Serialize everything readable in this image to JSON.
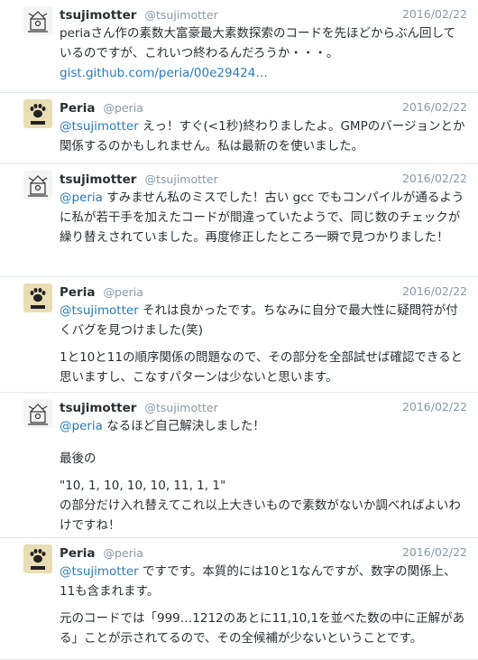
{
  "tweets": [
    {
      "author": "tsujimotter",
      "handle": "@tsujimotter",
      "date": "2016/02/22",
      "avatar_icon": "rocket-doodle-icon",
      "paragraphs": [
        "periaさん作の素数大富豪最大素数探索のコードを先ほどからぶん回しているのですが、これいつ終わるんだろうか・・・。"
      ],
      "link": "gist.github.com/peria/00e29424…"
    },
    {
      "author": "Peria",
      "handle": "@peria",
      "date": "2016/02/22",
      "avatar_icon": "paw-print-icon",
      "mention": "@tsujimotter",
      "first_text": " えっ！すぐ(<1秒)終わりましたよ。GMPのバージョンとか関係するのかもしれません。私は最新のを使いました。",
      "paragraphs": []
    },
    {
      "author": "tsujimotter",
      "handle": "@tsujimotter",
      "date": "2016/02/22",
      "avatar_icon": "rocket-doodle-icon",
      "mention": "@peria",
      "first_text": " すみません私のミスでした！古い gcc でもコンパイルが通るように私が若干手を加えたコードが間違っていたようで、同じ数のチェックが繰り替えされていました。再度修正したところ一瞬で見つかりました！",
      "paragraphs": []
    },
    {
      "author": "Peria",
      "handle": "@peria",
      "date": "2016/02/22",
      "avatar_icon": "paw-print-icon",
      "mention": "@tsujimotter",
      "first_text": " それは良かったです。ちなみに自分で最大性に疑問符が付くバグを見つけました(笑)",
      "paragraphs": [
        "1と10と11の順序関係の問題なので、その部分を全部試せば確認できると思いますし、こなすパターンは少ないと思います。"
      ]
    },
    {
      "author": "tsujimotter",
      "handle": "@tsujimotter",
      "date": "2016/02/22",
      "avatar_icon": "rocket-doodle-icon",
      "mention": "@peria",
      "first_text": " なるほど自己解決しました！",
      "paragraphs": [
        "最後の",
        "\"10, 1, 10, 10, 10, 11, 1, 1\"\nの部分だけ入れ替えてこれ以上大きいもので素数がないか調べればよいわけですね！"
      ]
    },
    {
      "author": "Peria",
      "handle": "@peria",
      "date": "2016/02/22",
      "avatar_icon": "paw-print-icon",
      "mention": "@tsujimotter",
      "first_text": " ですです。本質的には10と1なんですが、数字の関係上、11も含まれます。",
      "paragraphs": [
        "元のコードでは「999…1212のあとに11,10,1を並べた数の中に正解がある」ことが示されてるので、その全候補が少ないということです。"
      ]
    }
  ]
}
